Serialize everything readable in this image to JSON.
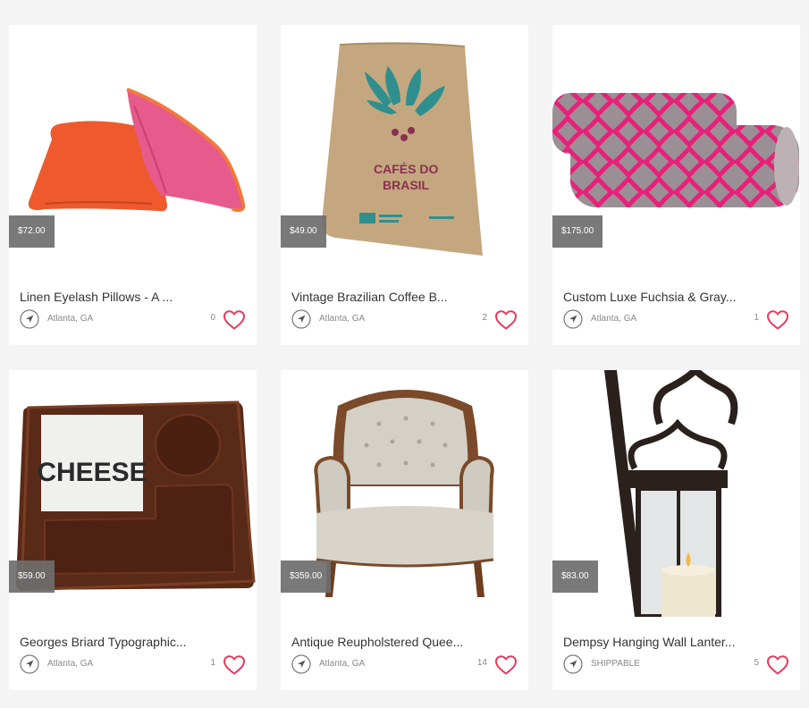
{
  "colors": {
    "background": "#f4f4f4",
    "card": "#ffffff",
    "price_badge": "#6e6e6e",
    "heart": "#e8385a",
    "text": "#333333",
    "muted": "#888888"
  },
  "listings": [
    {
      "title": "Linen Eyelash Pillows - A ...",
      "price": "$72.00",
      "location": "Atlanta, GA",
      "favorites": "0",
      "image": "pillows"
    },
    {
      "title": "Vintage Brazilian Coffee B...",
      "price": "$49.00",
      "location": "Atlanta, GA",
      "favorites": "2",
      "image": "coffee-sack",
      "image_text": [
        "CAFÉS DO",
        "BRASIL"
      ]
    },
    {
      "title": "Custom Luxe Fuchsia & Gray...",
      "price": "$175.00",
      "location": "Atlanta, GA",
      "favorites": "1",
      "image": "bolster-pillows"
    },
    {
      "title": "Georges Briard Typographic...",
      "price": "$59.00",
      "location": "Atlanta, GA",
      "favorites": "1",
      "image": "cheese-board",
      "image_text": [
        "CHEESE"
      ]
    },
    {
      "title": "Antique Reupholstered Quee...",
      "price": "$359.00",
      "location": "Atlanta, GA",
      "favorites": "14",
      "image": "armchair"
    },
    {
      "title": "Dempsy Hanging Wall Lanter...",
      "price": "$83.00",
      "location": "SHIPPABLE",
      "favorites": "5",
      "image": "lantern"
    }
  ],
  "icons": {
    "location": "navigation-arrow-icon",
    "favorite": "heart-outline-icon"
  }
}
